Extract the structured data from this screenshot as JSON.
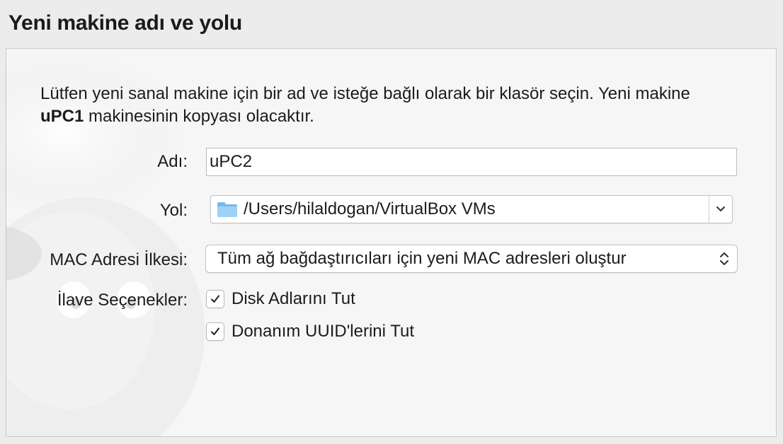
{
  "page": {
    "title": "Yeni makine adı ve yolu"
  },
  "description": {
    "part1": "Lütfen yeni sanal makine için bir ad ve isteğe bağlı olarak bir klasör seçin. Yeni makine ",
    "machine_name": "uPC1",
    "part2": " makinesinin kopyası olacaktır."
  },
  "form": {
    "name_label": "Adı:",
    "name_value": "uPC2",
    "path_label": "Yol:",
    "path_value": "/Users/hilaldogan/VirtualBox VMs",
    "mac_label": "MAC Adresi İlkesi:",
    "mac_value": "Tüm ağ bağdaştırıcıları için yeni MAC adresleri oluştur",
    "options_label": "İlave Seçenekler:",
    "options": [
      {
        "label": "Disk Adlarını Tut",
        "checked": true
      },
      {
        "label": "Donanım UUID'lerini Tut",
        "checked": true
      }
    ]
  },
  "icons": {
    "folder": "folder-icon",
    "chevron": "chevron-down-icon",
    "updown": "updown-arrows-icon",
    "check": "checkmark-icon"
  },
  "colors": {
    "folder": "#8cc4f0",
    "panel_bg": "#f6f6f6",
    "window_bg": "#ececec"
  }
}
